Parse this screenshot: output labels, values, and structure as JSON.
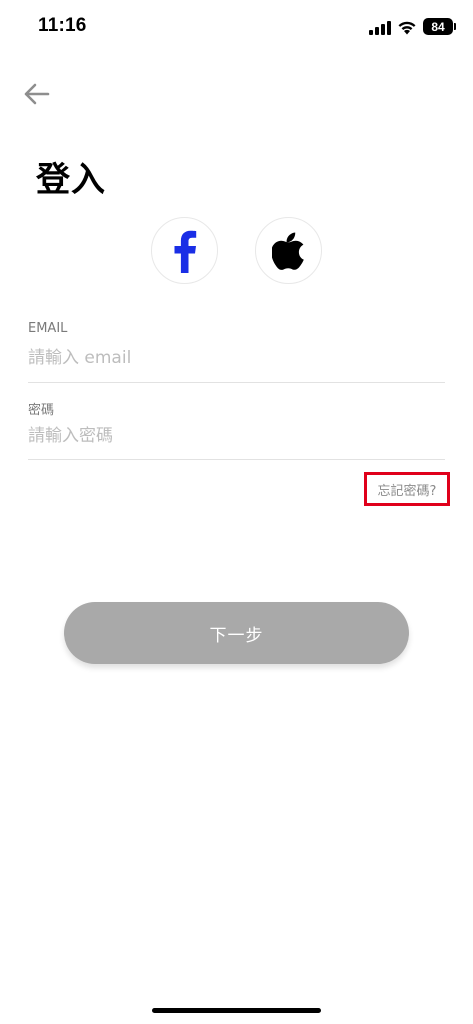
{
  "status_bar": {
    "time": "11:16",
    "battery_level": "84"
  },
  "header": {
    "back_icon": "arrow-left-icon",
    "title": "登入"
  },
  "social": {
    "facebook": {
      "icon": "facebook-icon",
      "letter": "f",
      "color": "#1a2ee6"
    },
    "apple": {
      "icon": "apple-icon",
      "color": "#000000"
    }
  },
  "form": {
    "email": {
      "label": "EMAIL",
      "placeholder": "請輸入 email",
      "value": ""
    },
    "password": {
      "label": "密碼",
      "placeholder": "請輸入密碼",
      "value": ""
    },
    "forgot_password": "忘記密碼?"
  },
  "actions": {
    "next_label": "下一步"
  },
  "colors": {
    "highlight_border": "#e0001b",
    "disabled_button": "#a9a9a9"
  }
}
